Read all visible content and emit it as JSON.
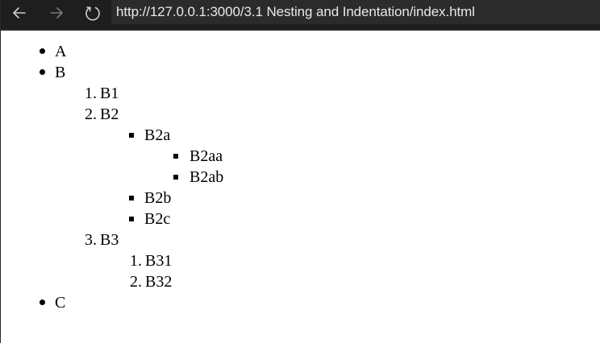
{
  "browser": {
    "url": "http://127.0.0.1:3000/3.1 Nesting and Indentation/index.html",
    "back_icon": "arrow-left-icon",
    "forward_icon": "arrow-right-icon",
    "reload_icon": "reload-icon"
  },
  "page": {
    "top_list": [
      {
        "label": "A"
      },
      {
        "label": "B",
        "children": [
          {
            "number": "1.",
            "label": "B1"
          },
          {
            "number": "2.",
            "label": "B2",
            "children": [
              {
                "label": "B2a",
                "children": [
                  {
                    "label": "B2aa"
                  },
                  {
                    "label": "B2ab"
                  }
                ]
              },
              {
                "label": "B2b"
              },
              {
                "label": "B2c"
              }
            ]
          },
          {
            "number": "3.",
            "label": "B3",
            "children": [
              {
                "number": "1.",
                "label": "B31"
              },
              {
                "number": "2.",
                "label": "B32"
              }
            ]
          }
        ]
      },
      {
        "label": "C"
      }
    ]
  },
  "colors": {
    "toolbar_bg": "#1e1e1e",
    "address_bg": "#2b2b2b",
    "url_text": "#e8e8e8",
    "icon_color": "#cfcfcf",
    "icon_disabled": "#7a7a7a"
  }
}
